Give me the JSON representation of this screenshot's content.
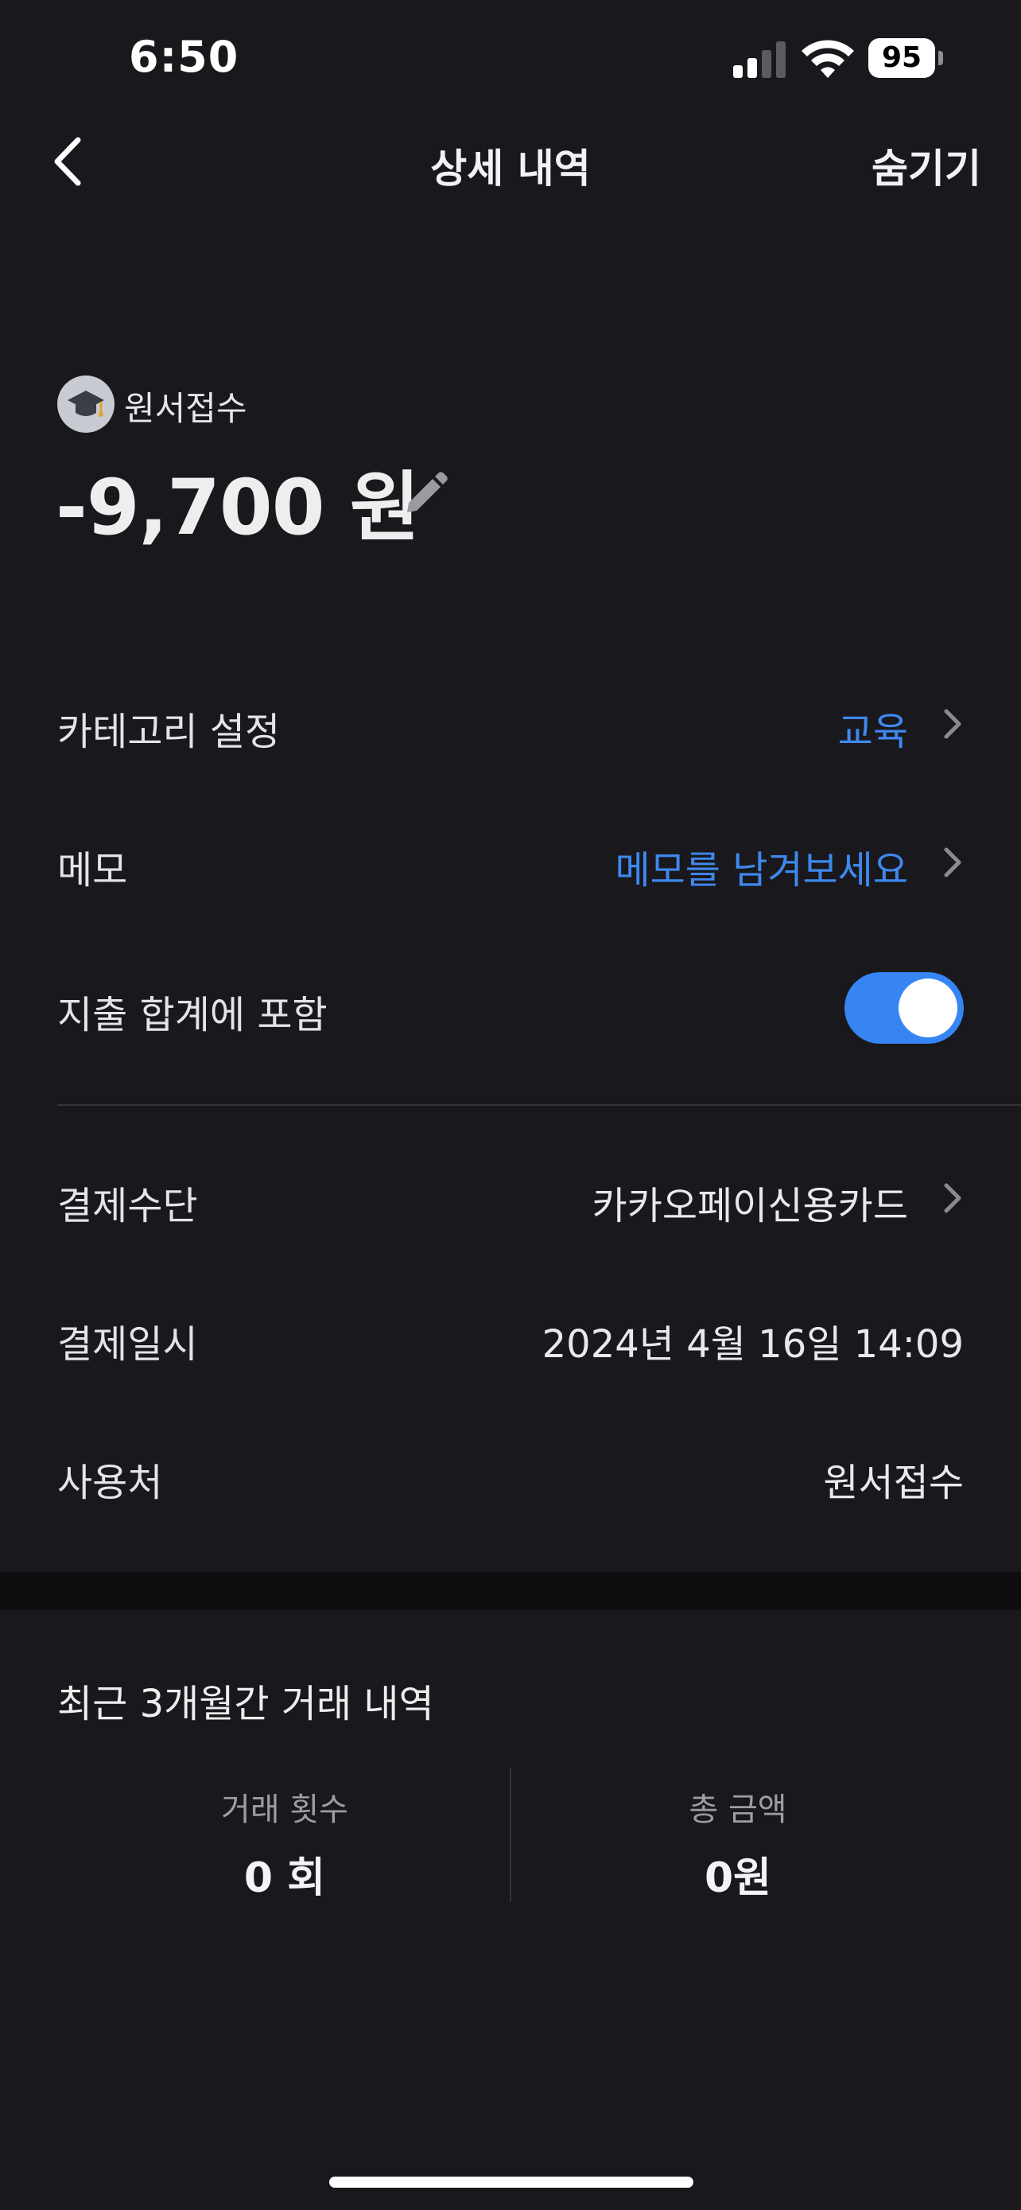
{
  "status_bar": {
    "time": "6:50",
    "battery": "95",
    "signal_icon": "cellular-signal-icon",
    "wifi_icon": "wifi-icon"
  },
  "nav": {
    "title": "상세 내역",
    "hide_label": "숨기기",
    "back_icon": "chevron-left-icon"
  },
  "header": {
    "category_icon": "graduation-cap-icon",
    "merchant": "원서접수",
    "amount": "-9,700 원",
    "edit_icon": "pencil-icon"
  },
  "rows": {
    "category": {
      "label": "카테고리 설정",
      "value": "교육"
    },
    "memo": {
      "label": "메모",
      "value": "메모를 남겨보세요"
    },
    "include_total": {
      "label": "지출 합계에 포함",
      "enabled": true
    },
    "payment_method": {
      "label": "결제수단",
      "value": "카카오페이신용카드"
    },
    "payment_date": {
      "label": "결제일시",
      "value": "2024년 4월 16일 14:09"
    },
    "merchant": {
      "label": "사용처",
      "value": "원서접수"
    }
  },
  "recent": {
    "title": "최근 3개월간 거래 내역",
    "count_label": "거래 횟수",
    "count_value": "0 회",
    "total_label": "총 금액",
    "total_value": "0원"
  },
  "colors": {
    "background": "#18181d",
    "accent": "#3f88ee",
    "toggle_on": "#3784f3"
  }
}
